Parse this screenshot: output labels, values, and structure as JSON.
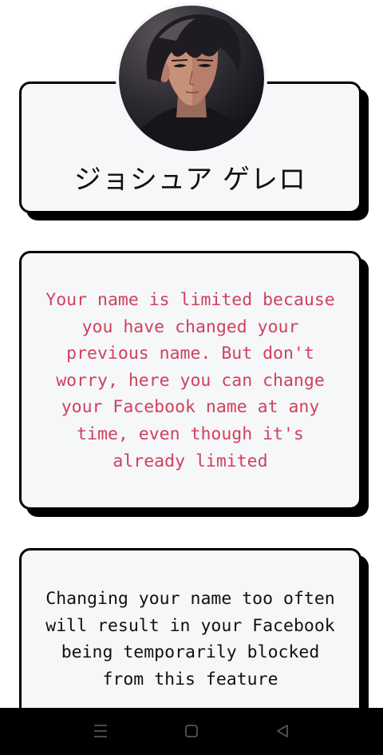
{
  "profile": {
    "avatar_icon": "anime-portrait-avatar",
    "name": "ジョシュア ゲレロ"
  },
  "warning": {
    "message": "Your name is limited because you have changed your previous name. But don't worry, here you can change your Facebook name at any time, even though it's already limited",
    "color": "#d0415e"
  },
  "info": {
    "message": "Changing your name too often will result in your Facebook being temporarily blocked from this feature"
  },
  "navbar": {
    "items": [
      {
        "icon": "menu-icon"
      },
      {
        "icon": "home-square-icon"
      },
      {
        "icon": "back-triangle-icon"
      }
    ]
  }
}
